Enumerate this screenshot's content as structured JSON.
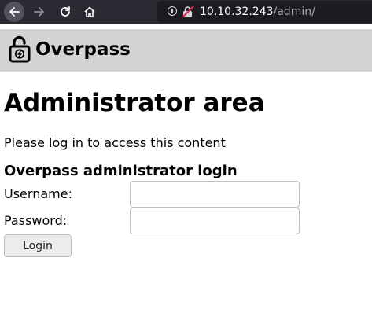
{
  "browser": {
    "url_host": "10.10.32.243",
    "url_path": "/admin/",
    "icons": [
      "back-icon",
      "forward-icon",
      "reload-icon",
      "home-icon",
      "info-icon",
      "insecure-lock-icon"
    ]
  },
  "header": {
    "site_title": "Overpass",
    "logo_icon": "open-lock-icon",
    "background": "#d3d3d3"
  },
  "main": {
    "title": "Administrator area",
    "intro": "Please log in to access this content",
    "login_heading": "Overpass administrator login",
    "username_label": "Username:",
    "password_label": "Password:",
    "username_value": "",
    "password_value": "",
    "login_button": "Login"
  }
}
